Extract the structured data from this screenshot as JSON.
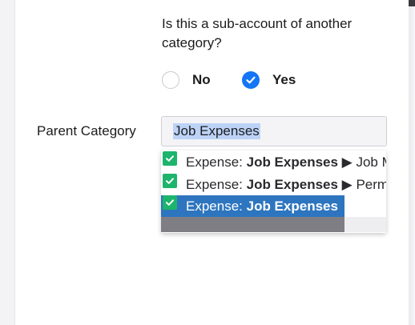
{
  "form": {
    "question": "Is this a sub-account of another category?",
    "options": [
      {
        "label": "No",
        "checked": false
      },
      {
        "label": "Yes",
        "checked": true
      }
    ],
    "parent_label": "Parent Category",
    "parent_value": "Job Expenses"
  },
  "dropdown": {
    "items": [
      {
        "prefix": "Expense: ",
        "bold": "Job Expenses",
        "suffix": " ▶ Job M",
        "selected": false
      },
      {
        "prefix": "Expense: ",
        "bold": "Job Expenses",
        "suffix": " ▶ Perm",
        "selected": false
      },
      {
        "prefix": "Expense: ",
        "bold": "Job Expenses",
        "suffix": "",
        "selected": true
      }
    ]
  },
  "colors": {
    "accent": "#1475f5",
    "selection": "#2e75bf",
    "check": "#1db46c",
    "text_highlight": "#bcd3f7"
  }
}
